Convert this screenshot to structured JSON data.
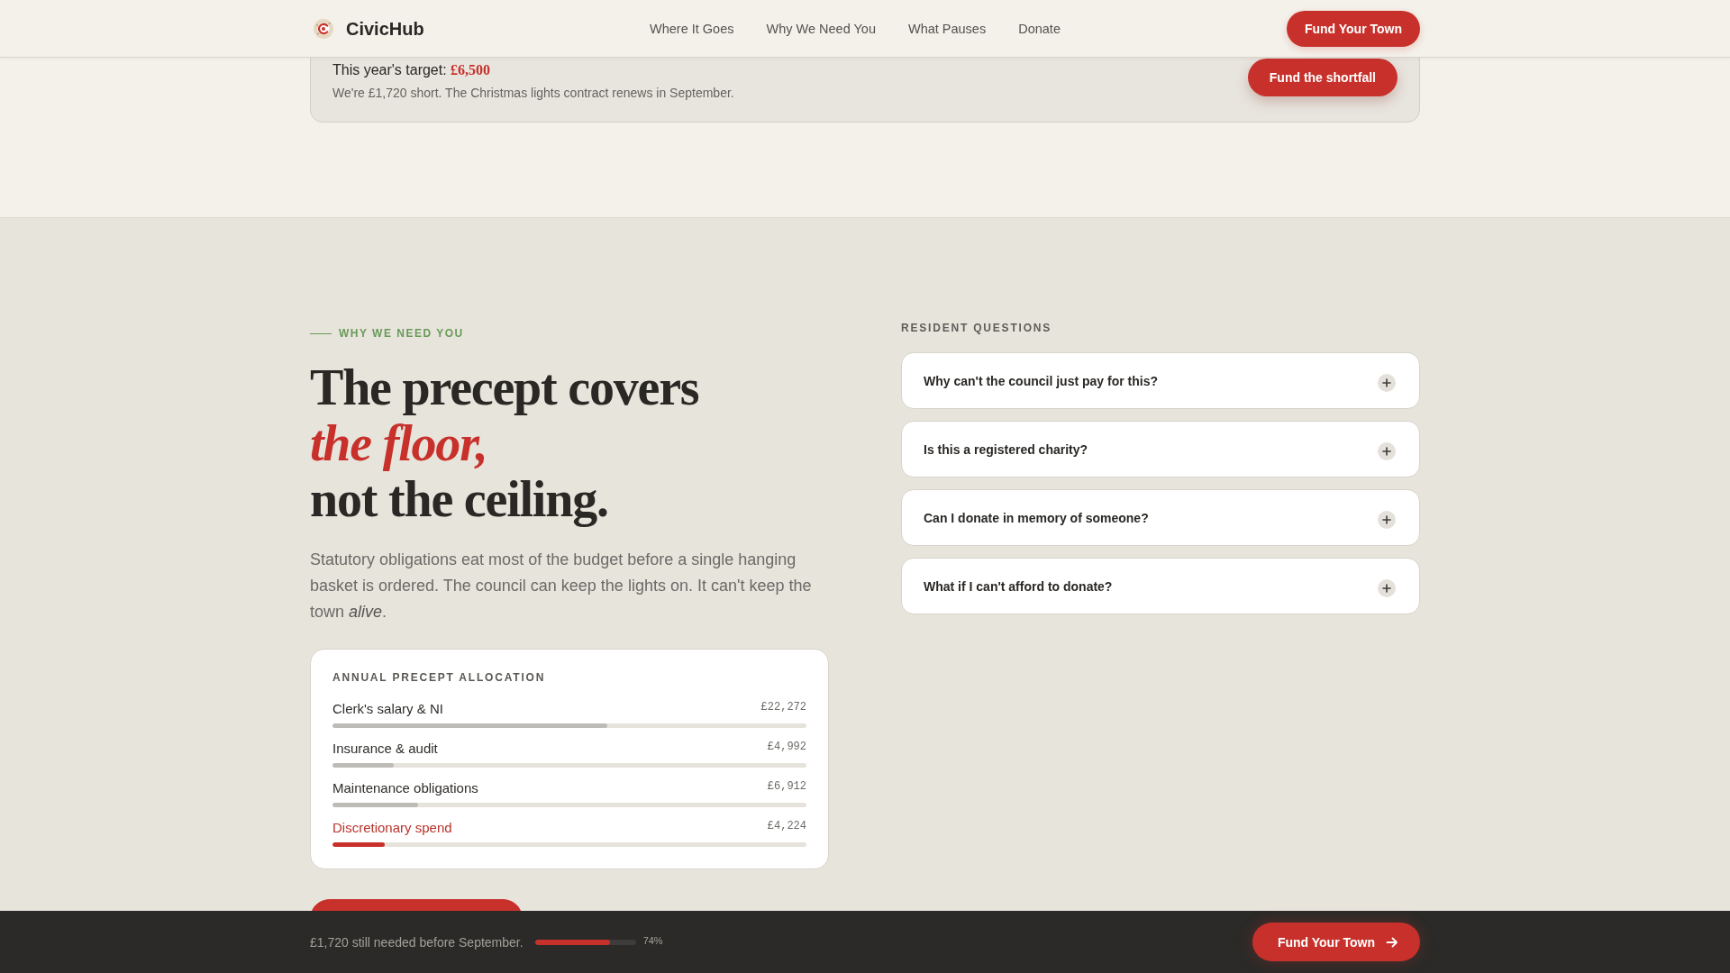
{
  "header": {
    "brand": "CivicHub",
    "nav": [
      {
        "label": "Where It Goes"
      },
      {
        "label": "Why We Need You"
      },
      {
        "label": "What Pauses"
      },
      {
        "label": "Donate"
      }
    ],
    "button": "Fund Your Town"
  },
  "target_card": {
    "target": "This year's target: **£6,500**",
    "note": "We're £1,720 short. The Christmas lights contract renews in September.",
    "button": "Fund the shortfall"
  },
  "why_section": {
    "eyebrow": "WHY WE NEED YOU",
    "heading": "The precept covers *the floor,* not the ceiling.",
    "body": "Statutory obligations eat most of the budget before a single hanging basket is ordered. The council can keep the lights on. It can't keep the town *alive*.",
    "allocation": {
      "title": "ANNUAL PRECEPT ALLOCATION",
      "rows": [
        {
          "label": "Clerk's salary & NI",
          "amount": "£22,272",
          "level": 0.58,
          "highlighted": false
        },
        {
          "label": "Insurance & audit",
          "amount": "£4,992",
          "level": 0.13,
          "highlighted": false
        },
        {
          "label": "Maintenance obligations",
          "amount": "£6,912",
          "level": 0.18,
          "highlighted": false
        },
        {
          "label": "Discretionary spend",
          "amount": "£4,224",
          "level": 0.11,
          "highlighted": true
        }
      ]
    }
  },
  "questions": {
    "title": "RESIDENT QUESTIONS",
    "items": [
      {
        "question": "Why can't the council just pay for this?",
        "expanded": false
      },
      {
        "question": "Is this a registered charity?",
        "expanded": false
      },
      {
        "question": "Can I donate in memory of someone?",
        "expanded": false
      },
      {
        "question": "What if I can't afford to donate?",
        "expanded": false
      }
    ]
  },
  "sticky_bar": {
    "text": "£1,720 still needed before September.",
    "level": 0.74,
    "reading": "74%",
    "button": "Fund Your Town"
  }
}
